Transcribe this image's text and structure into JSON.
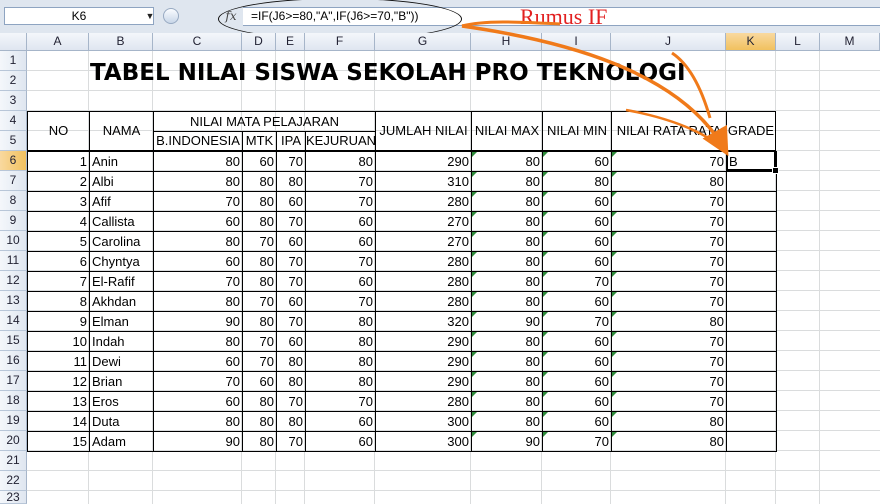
{
  "formula_bar": {
    "name_box": "K6",
    "fx_label": "fx",
    "formula": "=IF(J6>=80,\"A\",IF(J6>=70,\"B\"))"
  },
  "annotation": {
    "label": "Rumus IF",
    "color": "#e22020"
  },
  "columns": [
    "A",
    "B",
    "C",
    "D",
    "E",
    "F",
    "G",
    "H",
    "I",
    "J",
    "K",
    "L",
    "M"
  ],
  "rows": [
    "1",
    "2",
    "3",
    "4",
    "5",
    "6",
    "7",
    "8",
    "9",
    "10",
    "11",
    "12",
    "13",
    "14",
    "15",
    "16",
    "17",
    "18",
    "19",
    "20",
    "21",
    "22",
    "23"
  ],
  "sheet": {
    "title": "TABEL NILAI SISWA SEKOLAH PRO TEKNOLOGI",
    "headers": {
      "no": "NO",
      "nama": "NAMA",
      "nilai_mata_pelajaran": "NILAI MATA PELAJARAN",
      "subjects": [
        "B.INDONESIA",
        "MTK",
        "IPA",
        "KEJURUAN"
      ],
      "jumlah": "JUMLAH NILAI",
      "max": "NILAI MAX",
      "min": "NILAI MIN",
      "rata": "NILAI RATA RATA",
      "grade": "GRADE"
    },
    "students": [
      {
        "no": "1",
        "nama": "Anin",
        "bind": "80",
        "mtk": "60",
        "ipa": "70",
        "kej": "80",
        "jumlah": "290",
        "max": "80",
        "min": "60",
        "rata": "70",
        "grade": "B"
      },
      {
        "no": "2",
        "nama": "Albi",
        "bind": "80",
        "mtk": "80",
        "ipa": "80",
        "kej": "70",
        "jumlah": "310",
        "max": "80",
        "min": "80",
        "rata": "80",
        "grade": ""
      },
      {
        "no": "3",
        "nama": "Afif",
        "bind": "70",
        "mtk": "80",
        "ipa": "60",
        "kej": "70",
        "jumlah": "280",
        "max": "80",
        "min": "60",
        "rata": "70",
        "grade": ""
      },
      {
        "no": "4",
        "nama": "Callista",
        "bind": "60",
        "mtk": "80",
        "ipa": "70",
        "kej": "60",
        "jumlah": "270",
        "max": "80",
        "min": "60",
        "rata": "70",
        "grade": ""
      },
      {
        "no": "5",
        "nama": "Carolina",
        "bind": "80",
        "mtk": "70",
        "ipa": "60",
        "kej": "60",
        "jumlah": "270",
        "max": "80",
        "min": "60",
        "rata": "70",
        "grade": ""
      },
      {
        "no": "6",
        "nama": "Chyntya",
        "bind": "60",
        "mtk": "80",
        "ipa": "70",
        "kej": "70",
        "jumlah": "280",
        "max": "80",
        "min": "60",
        "rata": "70",
        "grade": ""
      },
      {
        "no": "7",
        "nama": "El-Rafif",
        "bind": "70",
        "mtk": "80",
        "ipa": "70",
        "kej": "60",
        "jumlah": "280",
        "max": "80",
        "min": "70",
        "rata": "70",
        "grade": ""
      },
      {
        "no": "8",
        "nama": "Akhdan",
        "bind": "80",
        "mtk": "70",
        "ipa": "60",
        "kej": "70",
        "jumlah": "280",
        "max": "80",
        "min": "60",
        "rata": "70",
        "grade": ""
      },
      {
        "no": "9",
        "nama": "Elman",
        "bind": "90",
        "mtk": "80",
        "ipa": "70",
        "kej": "80",
        "jumlah": "320",
        "max": "90",
        "min": "70",
        "rata": "80",
        "grade": ""
      },
      {
        "no": "10",
        "nama": "Indah",
        "bind": "80",
        "mtk": "70",
        "ipa": "60",
        "kej": "80",
        "jumlah": "290",
        "max": "80",
        "min": "60",
        "rata": "70",
        "grade": ""
      },
      {
        "no": "11",
        "nama": "Dewi",
        "bind": "60",
        "mtk": "70",
        "ipa": "80",
        "kej": "80",
        "jumlah": "290",
        "max": "80",
        "min": "60",
        "rata": "70",
        "grade": ""
      },
      {
        "no": "12",
        "nama": "Brian",
        "bind": "70",
        "mtk": "60",
        "ipa": "80",
        "kej": "80",
        "jumlah": "290",
        "max": "80",
        "min": "60",
        "rata": "70",
        "grade": ""
      },
      {
        "no": "13",
        "nama": "Eros",
        "bind": "60",
        "mtk": "80",
        "ipa": "70",
        "kej": "70",
        "jumlah": "280",
        "max": "80",
        "min": "60",
        "rata": "70",
        "grade": ""
      },
      {
        "no": "14",
        "nama": "Duta",
        "bind": "80",
        "mtk": "80",
        "ipa": "80",
        "kej": "60",
        "jumlah": "300",
        "max": "80",
        "min": "60",
        "rata": "80",
        "grade": ""
      },
      {
        "no": "15",
        "nama": "Adam",
        "bind": "90",
        "mtk": "80",
        "ipa": "70",
        "kej": "60",
        "jumlah": "300",
        "max": "90",
        "min": "70",
        "rata": "80",
        "grade": ""
      }
    ]
  }
}
